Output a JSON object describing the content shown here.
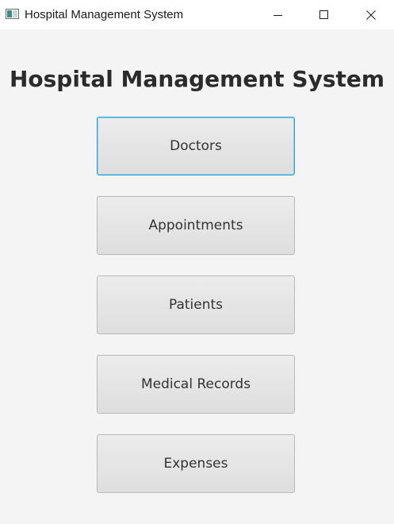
{
  "window": {
    "title": "Hospital Management System",
    "icon": "java-app-icon",
    "controls": [
      "minimize-icon",
      "maximize-icon",
      "close-icon"
    ]
  },
  "main": {
    "heading": "Hospital Management System",
    "buttons": [
      {
        "label": "Doctors",
        "focused": true
      },
      {
        "label": "Appointments",
        "focused": false
      },
      {
        "label": "Patients",
        "focused": false
      },
      {
        "label": "Medical Records",
        "focused": false
      },
      {
        "label": "Expenses",
        "focused": false
      }
    ]
  },
  "colors": {
    "background": "#f4f4f4",
    "titlebar": "#ffffff",
    "focus_border": "#2a9fd6",
    "button_border": "#b9b9b9",
    "text": "#333333"
  }
}
